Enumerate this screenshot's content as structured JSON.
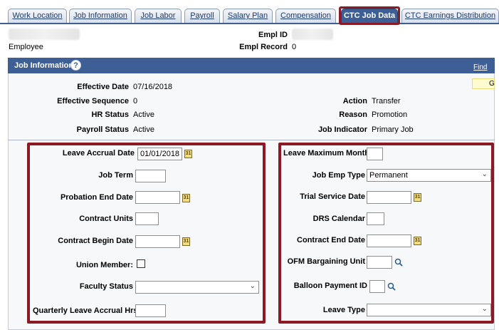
{
  "tabs": [
    {
      "label": "Work Location",
      "active": false
    },
    {
      "label": "Job Information",
      "active": false
    },
    {
      "label": "Job Labor",
      "active": false
    },
    {
      "label": "Payroll",
      "active": false
    },
    {
      "label": "Salary Plan",
      "active": false
    },
    {
      "label": "Compensation",
      "active": false
    },
    {
      "label": "CTC Job Data",
      "active": true
    },
    {
      "label": "CTC Earnings Distribution",
      "active": false
    }
  ],
  "header": {
    "employee_label": "Employee",
    "empl_id_label": "Empl ID",
    "empl_record_label": "Empl Record",
    "empl_record_value": "0"
  },
  "section": {
    "title": "Job Information",
    "help": "?",
    "find": "Find",
    "yellow_button": "G"
  },
  "job_info": {
    "effective_date_label": "Effective Date",
    "effective_date": "07/16/2018",
    "effective_sequence_label": "Effective Sequence",
    "effective_sequence": "0",
    "hr_status_label": "HR Status",
    "hr_status": "Active",
    "payroll_status_label": "Payroll Status",
    "payroll_status": "Active",
    "action_label": "Action",
    "action": "Transfer",
    "reason_label": "Reason",
    "reason": "Promotion",
    "job_indicator_label": "Job Indicator",
    "job_indicator": "Primary Job"
  },
  "left_fields": {
    "leave_accrual_date_label": "Leave Accrual Date",
    "leave_accrual_date": "01/01/2018",
    "job_term_label": "Job Term",
    "probation_end_date_label": "Probation End Date",
    "contract_units_label": "Contract Units",
    "contract_begin_date_label": "Contract Begin Date",
    "union_member_label": "Union Member:",
    "faculty_status_label": "Faculty Status",
    "quarterly_leave_label": "Quarterly Leave Accrual Hrs"
  },
  "right_fields": {
    "leave_max_month_label": "Leave Maximum Month",
    "job_emp_type_label": "Job Emp Type",
    "job_emp_type": "Permanent",
    "trial_service_date_label": "Trial Service Date",
    "drs_calendar_label": "DRS Calendar",
    "contract_end_date_label": "Contract End Date",
    "ofm_bargaining_unit_label": "OFM Bargaining Unit",
    "balloon_payment_id_label": "Balloon Payment ID",
    "leave_type_label": "Leave Type"
  },
  "icons": {
    "calendar": "calendar-icon",
    "lookup": "magnifier-icon",
    "dropdown": "chevron-down-icon"
  },
  "colors": {
    "highlight": "#8a1b24",
    "section_header": "#3d5f95"
  }
}
